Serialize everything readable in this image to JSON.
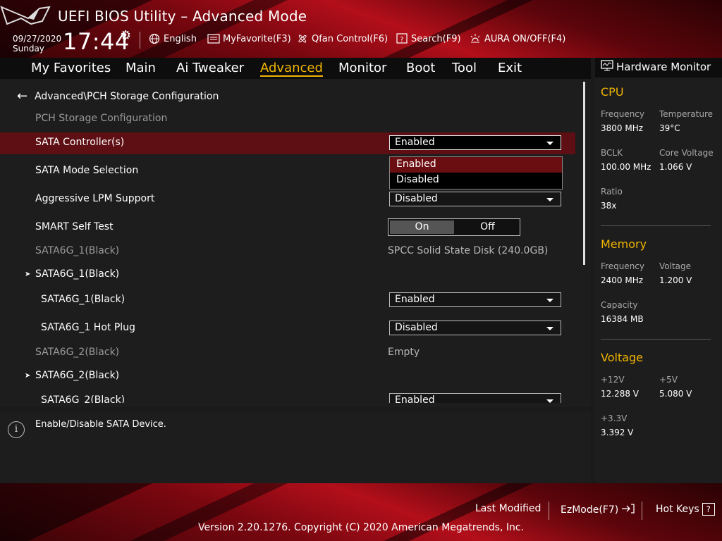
{
  "header": {
    "title": "UEFI BIOS Utility – Advanced Mode",
    "date": "09/27/2020",
    "day": "Sunday",
    "time": "17:44",
    "tools": {
      "language": "English",
      "favorite": "MyFavorite(F3)",
      "qfan": "Qfan Control(F6)",
      "search": "Search(F9)",
      "aura": "AURA ON/OFF(F4)"
    }
  },
  "menu": {
    "items": [
      "My Favorites",
      "Main",
      "Ai Tweaker",
      "Advanced",
      "Monitor",
      "Boot",
      "Tool",
      "Exit"
    ],
    "active": "Advanced"
  },
  "page": {
    "breadcrumb": "Advanced\\PCH Storage Configuration",
    "section_title": "PCH Storage Configuration",
    "rows": {
      "sata_controller": {
        "label": "SATA Controller(s)",
        "value": "Enabled"
      },
      "sata_mode": {
        "label": "SATA Mode Selection"
      },
      "aggressive_lpm": {
        "label": "Aggressive LPM Support",
        "value": "Disabled"
      },
      "smart_self_test": {
        "label": "SMART Self Test",
        "on": "On",
        "off": "Off"
      },
      "sata6g_1_info": {
        "label": "SATA6G_1(Black)",
        "value": "SPCC Solid State Disk (240.0GB)"
      },
      "sata6g_1_group": {
        "label": "SATA6G_1(Black)"
      },
      "sata6g_1_port": {
        "label": "SATA6G_1(Black)",
        "value": "Enabled"
      },
      "sata6g_1_hotplug": {
        "label": "SATA6G_1 Hot Plug",
        "value": "Disabled"
      },
      "sata6g_2_info": {
        "label": "SATA6G_2(Black)",
        "value": "Empty"
      },
      "sata6g_2_group": {
        "label": "SATA6G_2(Black)"
      },
      "sata6g_2_port": {
        "label": "SATA6G_2(Black)",
        "value": "Enabled"
      }
    },
    "dropdown_options": [
      "Enabled",
      "Disabled"
    ]
  },
  "help": {
    "text": "Enable/Disable SATA Device."
  },
  "hardware_monitor": {
    "title": "Hardware Monitor",
    "cpu": {
      "heading": "CPU",
      "frequency_label": "Frequency",
      "frequency": "3800 MHz",
      "temperature_label": "Temperature",
      "temperature": "39°C",
      "bclk_label": "BCLK",
      "bclk": "100.00 MHz",
      "core_voltage_label": "Core Voltage",
      "core_voltage": "1.066 V",
      "ratio_label": "Ratio",
      "ratio": "38x"
    },
    "memory": {
      "heading": "Memory",
      "frequency_label": "Frequency",
      "frequency": "2400 MHz",
      "voltage_label": "Voltage",
      "voltage": "1.200 V",
      "capacity_label": "Capacity",
      "capacity": "16384 MB"
    },
    "voltage": {
      "heading": "Voltage",
      "v12_label": "+12V",
      "v12": "12.288 V",
      "v5_label": "+5V",
      "v5": "5.080 V",
      "v33_label": "+3.3V",
      "v33": "3.392 V"
    }
  },
  "footer": {
    "last_modified": "Last Modified",
    "ezmode": "EzMode(F7)",
    "hotkeys": "Hot Keys",
    "hotkeys_key": "?",
    "version": "Version 2.20.1276. Copyright (C) 2020 American Megatrends, Inc."
  },
  "colors": {
    "accent": "#f0b400",
    "highlight_row": "#5e0f13",
    "brand_red": "#b30f1a"
  }
}
